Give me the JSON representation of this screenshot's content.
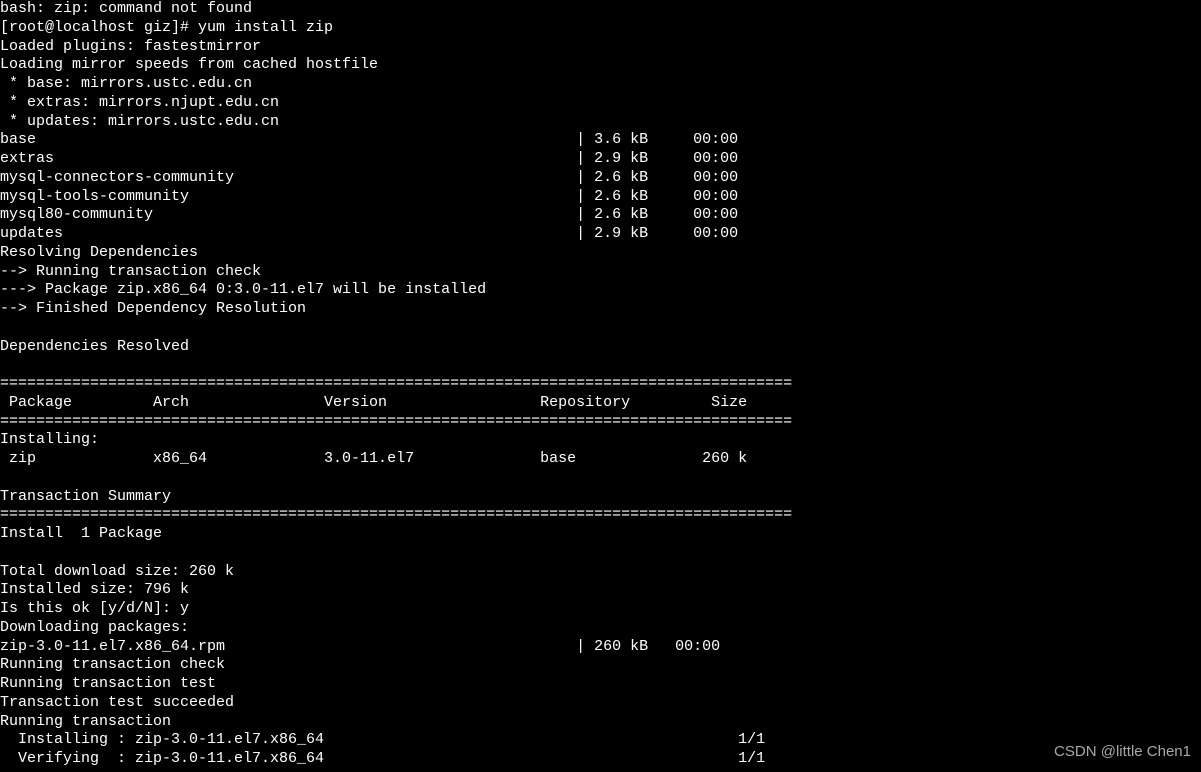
{
  "terminal": {
    "lines": [
      "bash: zip: command not found",
      "[root@localhost giz]# yum install zip",
      "Loaded plugins: fastestmirror",
      "Loading mirror speeds from cached hostfile",
      " * base: mirrors.ustc.edu.cn",
      " * extras: mirrors.njupt.edu.cn",
      " * updates: mirrors.ustc.edu.cn",
      "base                                                            | 3.6 kB     00:00",
      "extras                                                          | 2.9 kB     00:00",
      "mysql-connectors-community                                      | 2.6 kB     00:00",
      "mysql-tools-community                                           | 2.6 kB     00:00",
      "mysql80-community                                               | 2.6 kB     00:00",
      "updates                                                         | 2.9 kB     00:00",
      "Resolving Dependencies",
      "--> Running transaction check",
      "---> Package zip.x86_64 0:3.0-11.el7 will be installed",
      "--> Finished Dependency Resolution",
      "",
      "Dependencies Resolved",
      "",
      "========================================================================================",
      " Package         Arch               Version                 Repository         Size",
      "========================================================================================",
      "Installing:",
      " zip             x86_64             3.0-11.el7              base              260 k",
      "",
      "Transaction Summary",
      "========================================================================================",
      "Install  1 Package",
      "",
      "Total download size: 260 k",
      "Installed size: 796 k",
      "Is this ok [y/d/N]: y",
      "Downloading packages:",
      "zip-3.0-11.el7.x86_64.rpm                                       | 260 kB   00:00",
      "Running transaction check",
      "Running transaction test",
      "Transaction test succeeded",
      "Running transaction",
      "  Installing : zip-3.0-11.el7.x86_64                                              1/1",
      "  Verifying  : zip-3.0-11.el7.x86_64                                              1/1"
    ]
  },
  "prompt": {
    "user": "root",
    "host": "localhost",
    "path": "giz",
    "command": "yum install zip"
  },
  "repos": [
    {
      "name": "base",
      "size": "3.6 kB",
      "time": "00:00"
    },
    {
      "name": "extras",
      "size": "2.9 kB",
      "time": "00:00"
    },
    {
      "name": "mysql-connectors-community",
      "size": "2.6 kB",
      "time": "00:00"
    },
    {
      "name": "mysql-tools-community",
      "size": "2.6 kB",
      "time": "00:00"
    },
    {
      "name": "mysql80-community",
      "size": "2.6 kB",
      "time": "00:00"
    },
    {
      "name": "updates",
      "size": "2.9 kB",
      "time": "00:00"
    }
  ],
  "mirrors": {
    "base": "mirrors.ustc.edu.cn",
    "extras": "mirrors.njupt.edu.cn",
    "updates": "mirrors.ustc.edu.cn"
  },
  "package_table": {
    "headers": [
      "Package",
      "Arch",
      "Version",
      "Repository",
      "Size"
    ],
    "rows": [
      {
        "package": "zip",
        "arch": "x86_64",
        "version": "3.0-11.el7",
        "repository": "base",
        "size": "260 k"
      }
    ]
  },
  "summary": {
    "install_count": "1 Package",
    "download_size": "260 k",
    "installed_size": "796 k",
    "confirm_prompt": "Is this ok [y/d/N]:",
    "confirm_answer": "y"
  },
  "download": {
    "file": "zip-3.0-11.el7.x86_64.rpm",
    "size": "260 kB",
    "time": "00:00"
  },
  "transaction": {
    "installing": "zip-3.0-11.el7.x86_64",
    "installing_progress": "1/1",
    "verifying": "zip-3.0-11.el7.x86_64",
    "verifying_progress": "1/1"
  },
  "watermark": "CSDN @little Chen1"
}
